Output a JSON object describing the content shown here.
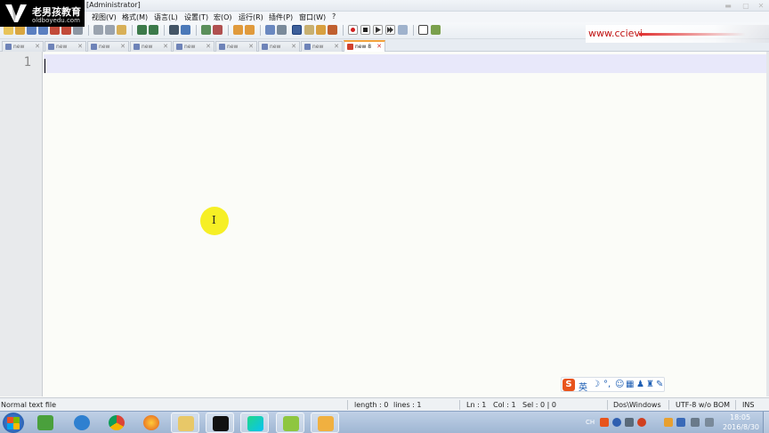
{
  "window": {
    "title": "[Administrator]"
  },
  "logo": {
    "name": "老男孩教育",
    "url": "oldboyedu.com"
  },
  "menu": [
    {
      "label": "视图(V)"
    },
    {
      "label": "格式(M)"
    },
    {
      "label": "语言(L)"
    },
    {
      "label": "设置(T)"
    },
    {
      "label": "宏(O)"
    },
    {
      "label": "运行(R)"
    },
    {
      "label": "插件(P)"
    },
    {
      "label": "窗口(W)"
    },
    {
      "label": "?"
    }
  ],
  "watermark": {
    "text": "www.ccievi"
  },
  "tabs": [
    {
      "label": "new"
    },
    {
      "label": "new"
    },
    {
      "label": "new"
    },
    {
      "label": "new"
    },
    {
      "label": "new"
    },
    {
      "label": "new"
    },
    {
      "label": "new"
    },
    {
      "label": "new"
    },
    {
      "label": "new 8",
      "active": true
    }
  ],
  "editor": {
    "line_number": "1"
  },
  "status": {
    "type": "Normal text file",
    "length": "length : 0",
    "lines": "lines : 1",
    "ln": "Ln : 1",
    "col": "Col : 1",
    "sel": "Sel : 0 | 0",
    "eol": "Dos\\Windows",
    "encoding": "UTF-8 w/o BOM",
    "mode": "INS"
  },
  "ime": {
    "s_label": "S",
    "lang": "英"
  },
  "tray": {
    "lang": "CH",
    "time": "18:05",
    "date": "2016/8/30"
  },
  "colors": {
    "accent_tab": "#f2a23c",
    "current_line": "#e8e8fa",
    "cursor_highlight": "#f6ee19",
    "watermark": "#c01010"
  }
}
